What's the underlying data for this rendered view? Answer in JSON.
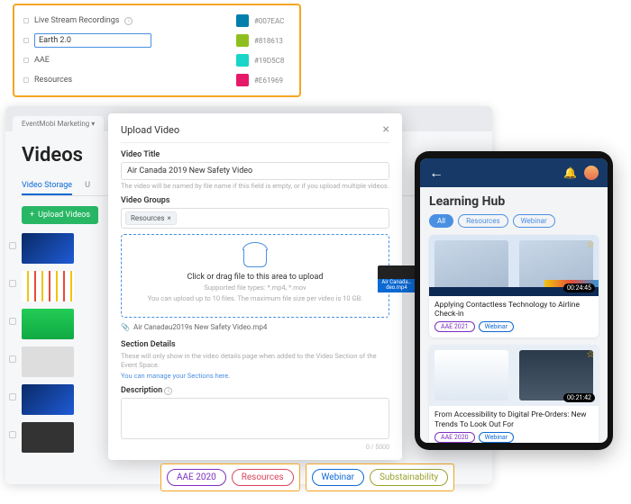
{
  "tag_panel": {
    "rows": [
      {
        "label": "Live Stream Recordings",
        "hex": "#007EAC",
        "swatch": "#007EAC",
        "info": true,
        "editing": false
      },
      {
        "label": "Earth 2.0",
        "hex": "#818613",
        "swatch": "#8fbf1f",
        "editing": true
      },
      {
        "label": "AAE",
        "hex": "#19D5C8",
        "swatch": "#19D5C8",
        "editing": false
      },
      {
        "label": "Resources",
        "hex": "#E61969",
        "swatch": "#E61969",
        "editing": false
      }
    ]
  },
  "browser": {
    "tab": "EventMobi Marketing",
    "title": "Videos",
    "subtabs": [
      "Video Storage",
      "U"
    ],
    "upload_btn": "Upload Videos"
  },
  "modal": {
    "header": "Upload Video",
    "title_label": "Video Title",
    "title_value": "Air Canada 2019 New Safety Video",
    "title_hint": "The video will be named by file name if this field is empty, or if you upload multiple videos.",
    "groups_label": "Video Groups",
    "group_chip": "Resources",
    "dz_main": "Click or drag file to this area to upload",
    "dz_sub": "Supported file types: *.mp4, *.mov",
    "dz_note": "You can upload up to 10 files. The maximum file size per video is 10 GB.",
    "drag_file": "Air Canada…deo.mp4",
    "attached": "Air Canadau2019s New Safety Video.mp4",
    "section_label": "Section Details",
    "section_hint": "These will only show in the video details page when added to the Video Section of the Event Space.",
    "section_link": "You can manage your Sections here.",
    "desc_label": "Description",
    "counter": "0 / 5000"
  },
  "tablet": {
    "title": "Learning Hub",
    "filters": [
      "All",
      "Resources",
      "Webinar"
    ],
    "cards": [
      {
        "title": "Applying Contactless Technology to Airline Check-in",
        "runtime": "00:24:45",
        "tags": [
          {
            "t": "AAE 2021",
            "c": "purple"
          },
          {
            "t": "Webinar",
            "c": "blue"
          }
        ]
      },
      {
        "title": "From Accessibility to Digital Pre-Orders: New Trends To Look Out For",
        "runtime": "00:21:42",
        "tags": [
          {
            "t": "AAE 2020",
            "c": "purple"
          },
          {
            "t": "Webinar",
            "c": "blue"
          }
        ]
      }
    ]
  },
  "bottom_chips": {
    "g1": [
      {
        "t": "AAE 2020",
        "c": "purple"
      },
      {
        "t": "Resources",
        "c": "red"
      }
    ],
    "g2": [
      {
        "t": "Webinar",
        "c": "blue"
      },
      {
        "t": "Substainability",
        "c": "olive"
      }
    ]
  }
}
